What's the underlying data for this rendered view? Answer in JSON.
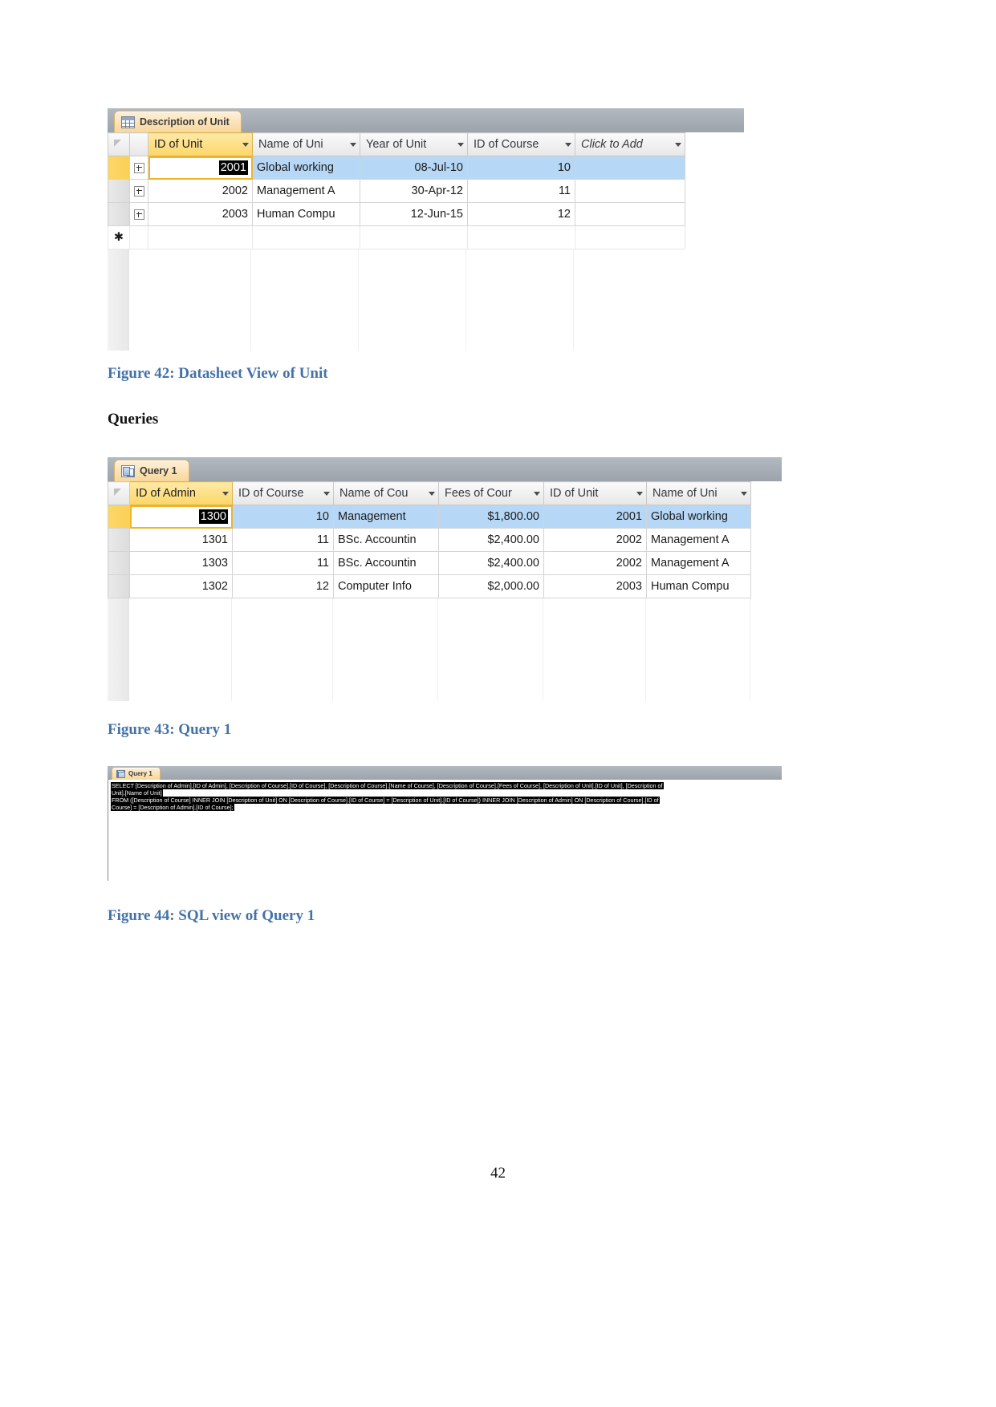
{
  "document": {
    "page_number": "42",
    "section_heading": "Queries",
    "figure42_caption": "Figure 42: Datasheet View of Unit",
    "figure43_caption": "Figure 43: Query 1",
    "figure44_caption": "Figure 44: SQL view of Query 1"
  },
  "unit_datasheet": {
    "tab_label": "Description of Unit",
    "tab_icon": "table-icon",
    "columns": [
      {
        "label": "ID of Unit",
        "selected": true
      },
      {
        "label": "Name of Uni",
        "selected": false
      },
      {
        "label": "Year of Unit",
        "selected": false
      },
      {
        "label": "ID of Course",
        "selected": false
      },
      {
        "label": "Click to Add",
        "selected": false
      }
    ],
    "rows": [
      {
        "current": true,
        "id_of_unit": "2001",
        "name_of_unit": "Global working",
        "year_of_unit": "08-Jul-10",
        "id_of_course": "10"
      },
      {
        "current": false,
        "id_of_unit": "2002",
        "name_of_unit": "Management A",
        "year_of_unit": "30-Apr-12",
        "id_of_course": "11"
      },
      {
        "current": false,
        "id_of_unit": "2003",
        "name_of_unit": "Human Compu",
        "year_of_unit": "12-Jun-15",
        "id_of_course": "12"
      }
    ],
    "new_record_marker": "✱"
  },
  "query_datasheet": {
    "tab_label": "Query 1",
    "tab_icon": "query-icon",
    "columns": [
      {
        "label": "ID of Admin",
        "selected": true
      },
      {
        "label": "ID of Course",
        "selected": false
      },
      {
        "label": "Name of Cou",
        "selected": false
      },
      {
        "label": "Fees of Cour",
        "selected": false
      },
      {
        "label": "ID of Unit",
        "selected": false
      },
      {
        "label": "Name of Uni",
        "selected": false
      }
    ],
    "rows": [
      {
        "current": true,
        "id_of_admin": "1300",
        "id_of_course": "10",
        "name_of_course": "Management",
        "fees_of_course": "$1,800.00",
        "id_of_unit": "2001",
        "name_of_unit": "Global working"
      },
      {
        "current": false,
        "id_of_admin": "1301",
        "id_of_course": "11",
        "name_of_course": "BSc. Accountin",
        "fees_of_course": "$2,400.00",
        "id_of_unit": "2002",
        "name_of_unit": "Management A"
      },
      {
        "current": false,
        "id_of_admin": "1303",
        "id_of_course": "11",
        "name_of_course": "BSc. Accountin",
        "fees_of_course": "$2,400.00",
        "id_of_unit": "2002",
        "name_of_unit": "Management A"
      },
      {
        "current": false,
        "id_of_admin": "1302",
        "id_of_course": "12",
        "name_of_course": "Computer Info",
        "fees_of_course": "$2,000.00",
        "id_of_unit": "2003",
        "name_of_unit": "Human Compu"
      }
    ]
  },
  "sql_view": {
    "tab_label": "Query 1",
    "tab_icon": "query-icon",
    "lines": [
      "SELECT [Description of Admin].[ID of Admin], [Description of Course].[ID of Course], [Description of Course].[Name of Course], [Description of Course].[Fees of Course], [Description of Unit].[ID of Unit], [Description of",
      "Unit].[Name of Unit]",
      "FROM ([Description of Course] INNER JOIN [Description of Unit] ON [Description of Course].[ID of Course] = [Description of Unit].[ID of Course]) INNER JOIN [Description of Admin] ON [Description of Course].[ID of",
      "Course] = [Description of Admin].[ID of Course];"
    ]
  },
  "colors": {
    "caption_blue": "#4472a8",
    "tab_orange": "#f8d79a",
    "header_yellow": "#fcd667",
    "row_highlight_blue": "#b6d7f5"
  }
}
